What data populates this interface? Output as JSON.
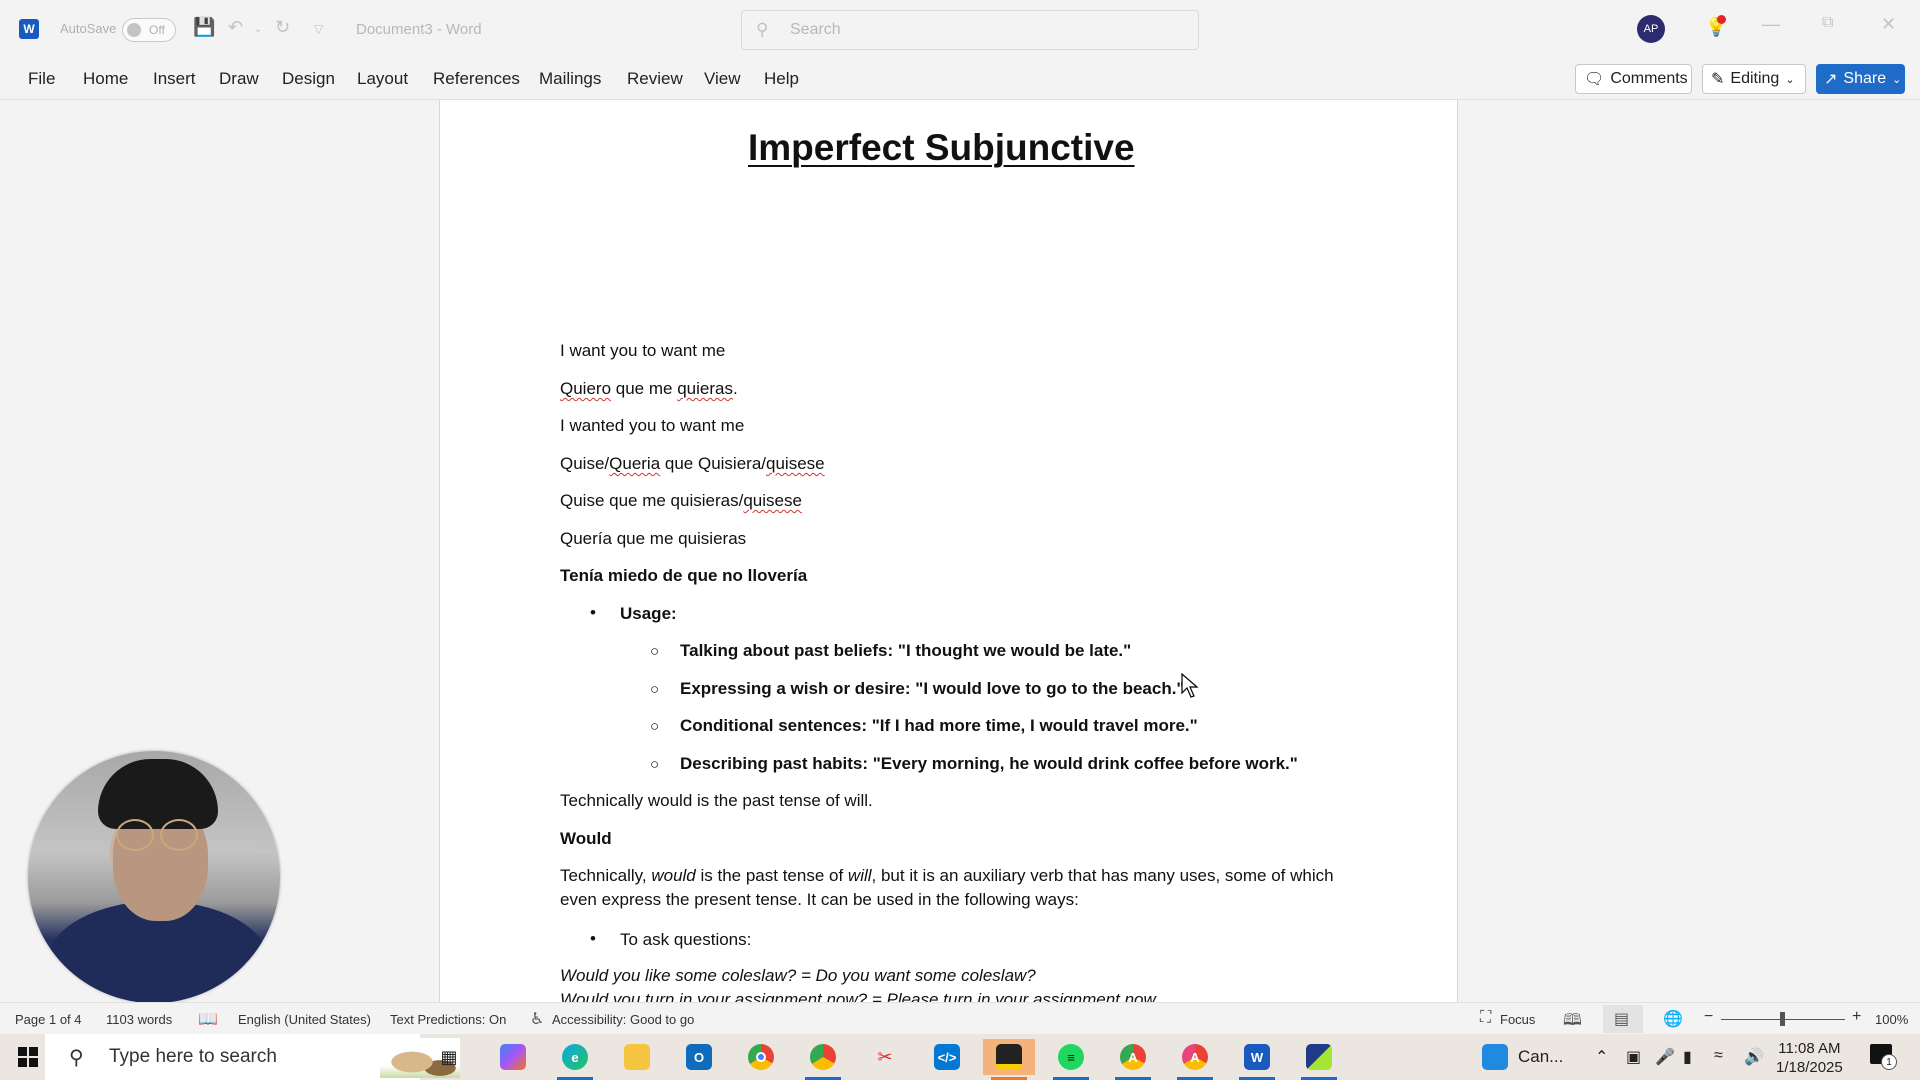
{
  "titlebar": {
    "autosave_label": "AutoSave",
    "autosave_state": "Off",
    "document_title": "Document3  -  Word",
    "search_placeholder": "Search",
    "avatar_initials": "AP",
    "app_icon_letter": "W"
  },
  "menu": {
    "items": [
      "File",
      "Home",
      "Insert",
      "Draw",
      "Design",
      "Layout",
      "References",
      "Mailings",
      "Review",
      "View",
      "Help"
    ],
    "comments_label": "Comments",
    "editing_label": "Editing",
    "share_label": "Share"
  },
  "document": {
    "title": "Imperfect Subjunctive",
    "lines": [
      "I want you to want me",
      "I wanted you to want me",
      "Quise que me quisieras/",
      "Quería que me quisieras",
      "Tenía miedo de que no llovería"
    ],
    "line2": {
      "w1": "Quiero",
      "w2": " que me ",
      "w3": "quieras",
      "w4": "."
    },
    "line4": {
      "w1": "Quise/",
      "w2": "Queria",
      "w3": " que Quisiera/",
      "w4": "quisese"
    },
    "line5_tail": "quisese",
    "usage_label": "Usage:",
    "usage_items": [
      "Talking about past beliefs: \"I thought we would be late.\"",
      "Expressing a wish or desire: \"I would love to go to the beach.\"",
      "Conditional sentences: \"If I had more time, I would travel more.\"",
      "Describing past habits: \"Every morning, he would drink coffee before work.\""
    ],
    "technically_line": "Technically would is the past tense of will.",
    "would_heading": "Would",
    "would_para": {
      "p1": "Technically, ",
      "p2": "would",
      "p3": " is the past tense of ",
      "p4": "will",
      "p5": ", but it is an auxiliary verb that has many uses, some of which even express the present tense. It can be used in the following ways:"
    },
    "ask_questions": "To ask questions:",
    "example1": "Would you like some coleslaw? = Do you want some coleslaw?",
    "example2": "Would you turn in your assignment now? = Please turn in your assignment now."
  },
  "statusbar": {
    "page": "Page 1 of 4",
    "words": "1103 words",
    "language": "English (United States)",
    "text_predictions": "Text Predictions: On",
    "accessibility": "Accessibility: Good to go",
    "focus_label": "Focus",
    "zoom_level": "100%",
    "zoom_percent": 100
  },
  "taskbar": {
    "search_placeholder": "Type here to search",
    "apps": [
      "Task View",
      "Copilot",
      "Microsoft Edge",
      "File Explorer",
      "Outlook",
      "Google Chrome",
      "Chrome (profile)",
      "Snipping Tool",
      "Visual Studio Code",
      "Sticky Notes",
      "Spotify",
      "Chrome (profile A)",
      "Chrome (profile A2)",
      "Word",
      "Canva App"
    ],
    "canva_label": "Can...",
    "time": "11:08 AM",
    "date": "1/18/2025",
    "notification_count": "1"
  },
  "colors": {
    "accent": "#1f6bc8",
    "word_blue": "#185abd",
    "avatar_bg": "#2b2b6e",
    "spellcheck": "#d13438"
  }
}
